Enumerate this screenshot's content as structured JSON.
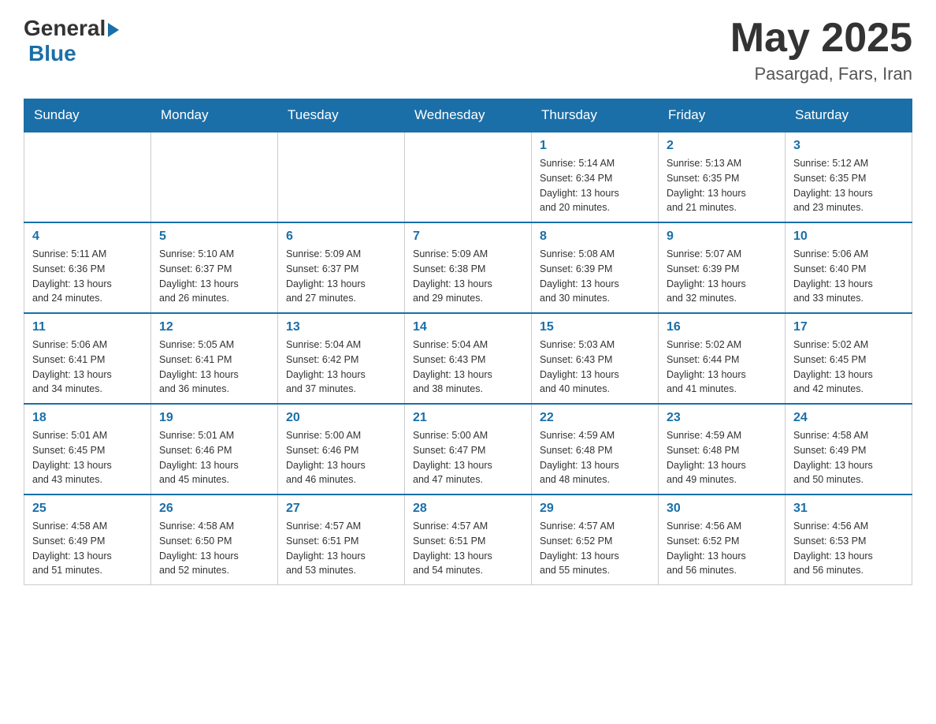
{
  "header": {
    "logo_general": "General",
    "logo_blue": "Blue",
    "month_year": "May 2025",
    "location": "Pasargad, Fars, Iran"
  },
  "days_of_week": [
    "Sunday",
    "Monday",
    "Tuesday",
    "Wednesday",
    "Thursday",
    "Friday",
    "Saturday"
  ],
  "weeks": [
    [
      {
        "day": "",
        "info": ""
      },
      {
        "day": "",
        "info": ""
      },
      {
        "day": "",
        "info": ""
      },
      {
        "day": "",
        "info": ""
      },
      {
        "day": "1",
        "info": "Sunrise: 5:14 AM\nSunset: 6:34 PM\nDaylight: 13 hours\nand 20 minutes."
      },
      {
        "day": "2",
        "info": "Sunrise: 5:13 AM\nSunset: 6:35 PM\nDaylight: 13 hours\nand 21 minutes."
      },
      {
        "day": "3",
        "info": "Sunrise: 5:12 AM\nSunset: 6:35 PM\nDaylight: 13 hours\nand 23 minutes."
      }
    ],
    [
      {
        "day": "4",
        "info": "Sunrise: 5:11 AM\nSunset: 6:36 PM\nDaylight: 13 hours\nand 24 minutes."
      },
      {
        "day": "5",
        "info": "Sunrise: 5:10 AM\nSunset: 6:37 PM\nDaylight: 13 hours\nand 26 minutes."
      },
      {
        "day": "6",
        "info": "Sunrise: 5:09 AM\nSunset: 6:37 PM\nDaylight: 13 hours\nand 27 minutes."
      },
      {
        "day": "7",
        "info": "Sunrise: 5:09 AM\nSunset: 6:38 PM\nDaylight: 13 hours\nand 29 minutes."
      },
      {
        "day": "8",
        "info": "Sunrise: 5:08 AM\nSunset: 6:39 PM\nDaylight: 13 hours\nand 30 minutes."
      },
      {
        "day": "9",
        "info": "Sunrise: 5:07 AM\nSunset: 6:39 PM\nDaylight: 13 hours\nand 32 minutes."
      },
      {
        "day": "10",
        "info": "Sunrise: 5:06 AM\nSunset: 6:40 PM\nDaylight: 13 hours\nand 33 minutes."
      }
    ],
    [
      {
        "day": "11",
        "info": "Sunrise: 5:06 AM\nSunset: 6:41 PM\nDaylight: 13 hours\nand 34 minutes."
      },
      {
        "day": "12",
        "info": "Sunrise: 5:05 AM\nSunset: 6:41 PM\nDaylight: 13 hours\nand 36 minutes."
      },
      {
        "day": "13",
        "info": "Sunrise: 5:04 AM\nSunset: 6:42 PM\nDaylight: 13 hours\nand 37 minutes."
      },
      {
        "day": "14",
        "info": "Sunrise: 5:04 AM\nSunset: 6:43 PM\nDaylight: 13 hours\nand 38 minutes."
      },
      {
        "day": "15",
        "info": "Sunrise: 5:03 AM\nSunset: 6:43 PM\nDaylight: 13 hours\nand 40 minutes."
      },
      {
        "day": "16",
        "info": "Sunrise: 5:02 AM\nSunset: 6:44 PM\nDaylight: 13 hours\nand 41 minutes."
      },
      {
        "day": "17",
        "info": "Sunrise: 5:02 AM\nSunset: 6:45 PM\nDaylight: 13 hours\nand 42 minutes."
      }
    ],
    [
      {
        "day": "18",
        "info": "Sunrise: 5:01 AM\nSunset: 6:45 PM\nDaylight: 13 hours\nand 43 minutes."
      },
      {
        "day": "19",
        "info": "Sunrise: 5:01 AM\nSunset: 6:46 PM\nDaylight: 13 hours\nand 45 minutes."
      },
      {
        "day": "20",
        "info": "Sunrise: 5:00 AM\nSunset: 6:46 PM\nDaylight: 13 hours\nand 46 minutes."
      },
      {
        "day": "21",
        "info": "Sunrise: 5:00 AM\nSunset: 6:47 PM\nDaylight: 13 hours\nand 47 minutes."
      },
      {
        "day": "22",
        "info": "Sunrise: 4:59 AM\nSunset: 6:48 PM\nDaylight: 13 hours\nand 48 minutes."
      },
      {
        "day": "23",
        "info": "Sunrise: 4:59 AM\nSunset: 6:48 PM\nDaylight: 13 hours\nand 49 minutes."
      },
      {
        "day": "24",
        "info": "Sunrise: 4:58 AM\nSunset: 6:49 PM\nDaylight: 13 hours\nand 50 minutes."
      }
    ],
    [
      {
        "day": "25",
        "info": "Sunrise: 4:58 AM\nSunset: 6:49 PM\nDaylight: 13 hours\nand 51 minutes."
      },
      {
        "day": "26",
        "info": "Sunrise: 4:58 AM\nSunset: 6:50 PM\nDaylight: 13 hours\nand 52 minutes."
      },
      {
        "day": "27",
        "info": "Sunrise: 4:57 AM\nSunset: 6:51 PM\nDaylight: 13 hours\nand 53 minutes."
      },
      {
        "day": "28",
        "info": "Sunrise: 4:57 AM\nSunset: 6:51 PM\nDaylight: 13 hours\nand 54 minutes."
      },
      {
        "day": "29",
        "info": "Sunrise: 4:57 AM\nSunset: 6:52 PM\nDaylight: 13 hours\nand 55 minutes."
      },
      {
        "day": "30",
        "info": "Sunrise: 4:56 AM\nSunset: 6:52 PM\nDaylight: 13 hours\nand 56 minutes."
      },
      {
        "day": "31",
        "info": "Sunrise: 4:56 AM\nSunset: 6:53 PM\nDaylight: 13 hours\nand 56 minutes."
      }
    ]
  ]
}
